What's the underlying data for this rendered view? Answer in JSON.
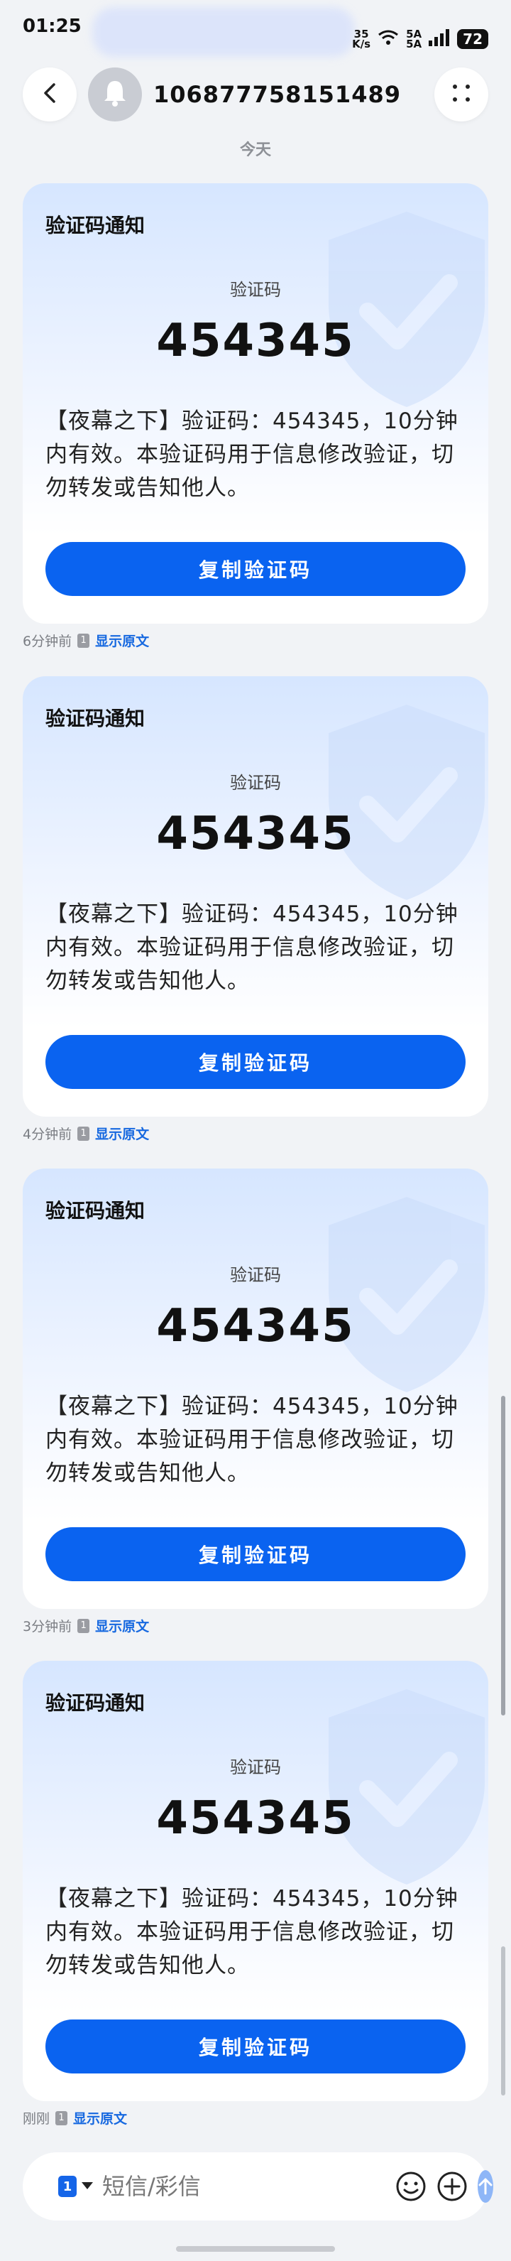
{
  "status_bar": {
    "time": "01:25",
    "net_speed_top": "35",
    "net_speed_bottom": "K/s",
    "signal_1": "5A",
    "signal_2": "5A",
    "battery": "72"
  },
  "header": {
    "sender_number": "106877758151489",
    "day_label": "今天"
  },
  "messages": [
    {
      "card_title": "验证码通知",
      "code_label": "验证码",
      "code": "454345",
      "body": "【夜幕之下】验证码：454345，10分钟内有效。本验证码用于信息修改验证，切勿转发或告知他人。",
      "copy_label": "复制验证码",
      "time": "6分钟前",
      "sim": "1",
      "show_original": "显示原文"
    },
    {
      "card_title": "验证码通知",
      "code_label": "验证码",
      "code": "454345",
      "body": "【夜幕之下】验证码：454345，10分钟内有效。本验证码用于信息修改验证，切勿转发或告知他人。",
      "copy_label": "复制验证码",
      "time": "4分钟前",
      "sim": "1",
      "show_original": "显示原文"
    },
    {
      "card_title": "验证码通知",
      "code_label": "验证码",
      "code": "454345",
      "body": "【夜幕之下】验证码：454345，10分钟内有效。本验证码用于信息修改验证，切勿转发或告知他人。",
      "copy_label": "复制验证码",
      "time": "3分钟前",
      "sim": "1",
      "show_original": "显示原文"
    },
    {
      "card_title": "验证码通知",
      "code_label": "验证码",
      "code": "454345",
      "body": "【夜幕之下】验证码：454345，10分钟内有效。本验证码用于信息修改验证，切勿转发或告知他人。",
      "copy_label": "复制验证码",
      "time": "刚刚",
      "sim": "1",
      "show_original": "显示原文"
    }
  ],
  "composer": {
    "sim": "1",
    "placeholder": "短信/彩信"
  },
  "icons": {
    "back": "back-chevron-icon",
    "avatar": "bell-icon",
    "more": "more-dots-icon",
    "shield": "shield-check-icon",
    "emoji": "emoji-icon",
    "add": "add-circle-icon",
    "send": "send-arrow-icon"
  },
  "colors": {
    "accent": "#0a63f0",
    "link": "#1769e0",
    "background": "#f1f3f6",
    "send_disabled": "#8eb6f7"
  }
}
